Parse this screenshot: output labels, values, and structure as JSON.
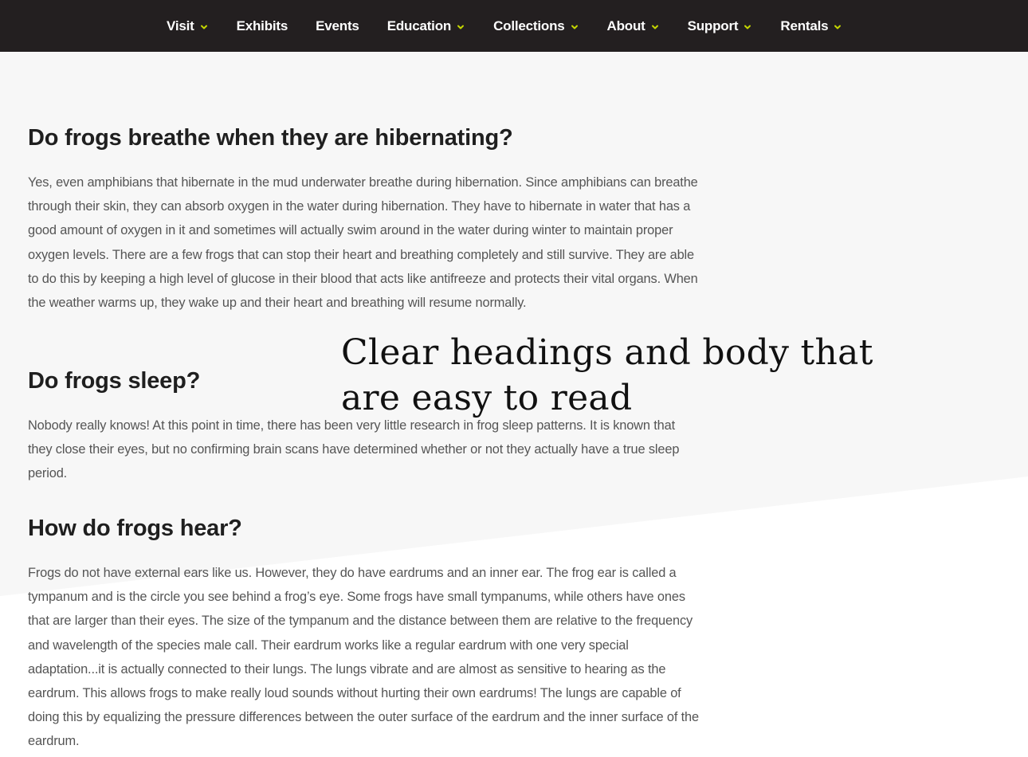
{
  "nav": {
    "items": [
      {
        "label": "Visit",
        "has_dropdown": true
      },
      {
        "label": "Exhibits",
        "has_dropdown": false
      },
      {
        "label": "Events",
        "has_dropdown": false
      },
      {
        "label": "Education",
        "has_dropdown": true
      },
      {
        "label": "Collections",
        "has_dropdown": true
      },
      {
        "label": "About",
        "has_dropdown": true
      },
      {
        "label": "Support",
        "has_dropdown": true
      },
      {
        "label": "Rentals",
        "has_dropdown": true
      }
    ],
    "dropdown_icon": "chevron-down-icon"
  },
  "faqs": [
    {
      "question": "Do frogs breathe when they are hibernating?",
      "answer": "Yes, even amphibians that hibernate in the mud underwater breathe during hibernation. Since amphibians can breathe through their skin, they can absorb oxygen in the water during hibernation. They have to hibernate in water that has a good amount of oxygen in it and sometimes will actually swim around in the water during winter to maintain proper oxygen levels. There are a few frogs that can stop their heart and breathing completely and still survive. They are able to do this by keeping a high level of glucose in their blood that acts like antifreeze and protects their vital organs. When the weather warms up, they wake up and their heart and breathing will resume normally."
    },
    {
      "question": "Do frogs sleep?",
      "answer": "Nobody really knows! At this point in time, there has been very little research in frog sleep patterns. It is known that they close their eyes, but no confirming brain scans have determined whether or not they actually have a true sleep period."
    },
    {
      "question": "How do frogs hear?",
      "answer": "Frogs do not have external ears like us. However, they do have eardrums and an inner ear. The frog ear is called a tympanum and is the circle you see behind a frog’s eye. Some frogs have small tympanums, while others have ones that are larger than their eyes. The size of the tympanum and the distance between them are relative to the frequency and wavelength of the species male call. Their eardrum works like a regular eardrum with one very special adaptation...it is actually connected to their lungs. The lungs vibrate and are almost as sensitive to hearing as the eardrum. This allows frogs to make really loud sounds without hurting their own eardrums! The lungs are capable of doing this by equalizing the pressure differences between the outer surface of the eardrum and the inner surface of the eardrum."
    }
  ],
  "overlay": {
    "caption": "Clear headings and body that are easy to read"
  },
  "colors": {
    "nav_background": "#231f20",
    "nav_text": "#ffffff",
    "chevron": "#c4d600",
    "page_band": "#f7f7f7",
    "page_white": "#ffffff",
    "heading_text": "#1f1f1f",
    "body_text": "#555555"
  }
}
